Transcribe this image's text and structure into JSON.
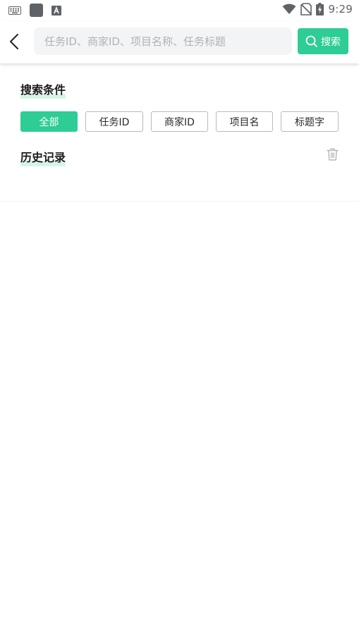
{
  "status_bar": {
    "time": "9:29",
    "left_icons": [
      "keyboard-icon",
      "app-square-icon",
      "font-a-icon"
    ],
    "right_icons": [
      "wifi-icon",
      "no-sim-icon",
      "battery-charging-icon"
    ]
  },
  "header": {
    "back_icon": "chevron-left-icon",
    "search": {
      "placeholder": "任务ID、商家ID、项目名称、任务标题",
      "value": ""
    },
    "search_button": {
      "label": "搜索",
      "icon": "search-icon"
    }
  },
  "criteria": {
    "title": "搜索条件",
    "chips": [
      {
        "label": "全部",
        "selected": true
      },
      {
        "label": "任务ID",
        "selected": false
      },
      {
        "label": "商家ID",
        "selected": false
      },
      {
        "label": "项目名",
        "selected": false
      },
      {
        "label": "标题字",
        "selected": false
      }
    ]
  },
  "history": {
    "title": "历史记录",
    "clear_icon": "trash-icon",
    "items": []
  },
  "colors": {
    "accent": "#2dcd95",
    "highlight": "#d4f5e6",
    "search_bg": "#f3f4f6",
    "placeholder": "#b0b2b6"
  }
}
